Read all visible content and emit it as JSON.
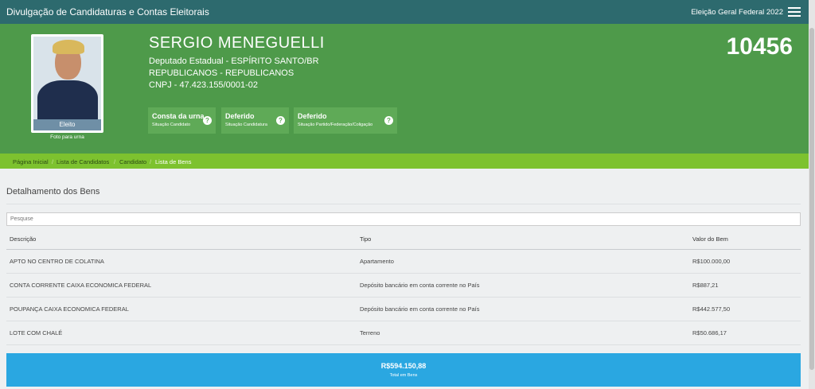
{
  "header": {
    "title": "Divulgação de Candidaturas e Contas Eleitorais",
    "election": "Eleição Geral Federal 2022",
    "menu_icon": "hamburger-icon"
  },
  "candidate": {
    "name": "SERGIO MENEGUELLI",
    "office": "Deputado Estadual - ESPÍRITO SANTO/BR",
    "party": "REPUBLICANOS - REPUBLICANOS",
    "cnpj": "CNPJ - 47.423.155/0001-02",
    "number": "10456",
    "photo_label": "Eleito",
    "photo_caption": "Foto para urna"
  },
  "statuses": [
    {
      "title": "Consta da urna",
      "subtitle": "Situação Candidato",
      "icon": "?"
    },
    {
      "title": "Deferido",
      "subtitle": "Situação Candidatura",
      "icon": "?"
    },
    {
      "title": "Deferido",
      "subtitle": "Situação Partido/Federação/Coligação",
      "icon": "?"
    }
  ],
  "breadcrumb": [
    "Página Inicial",
    "Lista de Candidatos",
    "Candidato",
    "Lista de Bens"
  ],
  "breadcrumb_sep": "/",
  "section_title": "Detalhamento dos Bens",
  "search_placeholder": "Pesquise",
  "table": {
    "headers": [
      "Descrição",
      "Tipo",
      "Valor do Bem"
    ],
    "rows": [
      [
        "APTO NO CENTRO DE COLATINA",
        "Apartamento",
        "R$100.000,00"
      ],
      [
        "CONTA CORRENTE CAIXA ECONOMICA FEDERAL",
        "Depósito bancário em conta corrente no País",
        "R$887,21"
      ],
      [
        "POUPANÇA CAIXA ECONOMICA FEDERAL",
        "Depósito bancário em conta corrente no País",
        "R$442.577,50"
      ],
      [
        "LOTE COM CHALÉ",
        "Terreno",
        "R$50.686,17"
      ]
    ]
  },
  "total": {
    "value": "R$594.150,88",
    "label": "Total em Bens"
  },
  "colors": {
    "topbar": "#2d6a6e",
    "hero": "#4e9a4a",
    "breadcrumb": "#7dc22f",
    "total": "#2aa7e1"
  }
}
